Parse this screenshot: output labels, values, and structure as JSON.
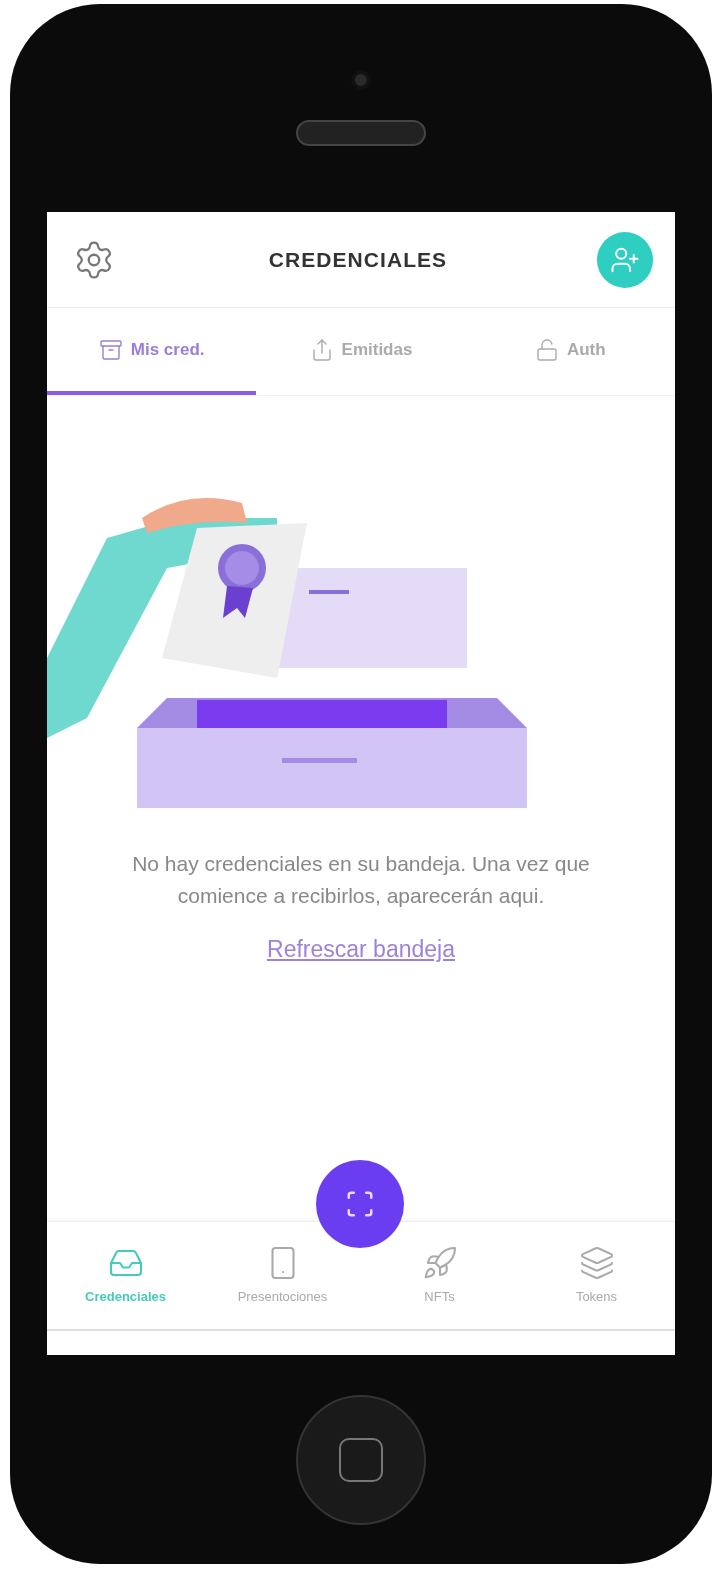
{
  "header": {
    "title": "CREDENCIALES"
  },
  "tabs": [
    {
      "label": "Mis cred.",
      "selected": true
    },
    {
      "label": "Emitidas",
      "selected": false
    },
    {
      "label": "Auth",
      "selected": false
    }
  ],
  "empty_state": {
    "message": "No hay credenciales en su bandeja. Una vez que comience a recibirlos, aparecerán aqui.",
    "link": "Refrescar bandeja"
  },
  "bottom_nav": [
    {
      "label": "Credenciales",
      "selected": true
    },
    {
      "label": "Presentociones",
      "selected": false
    },
    {
      "label": "NFTs",
      "selected": false
    },
    {
      "label": "Tokens",
      "selected": false
    }
  ]
}
